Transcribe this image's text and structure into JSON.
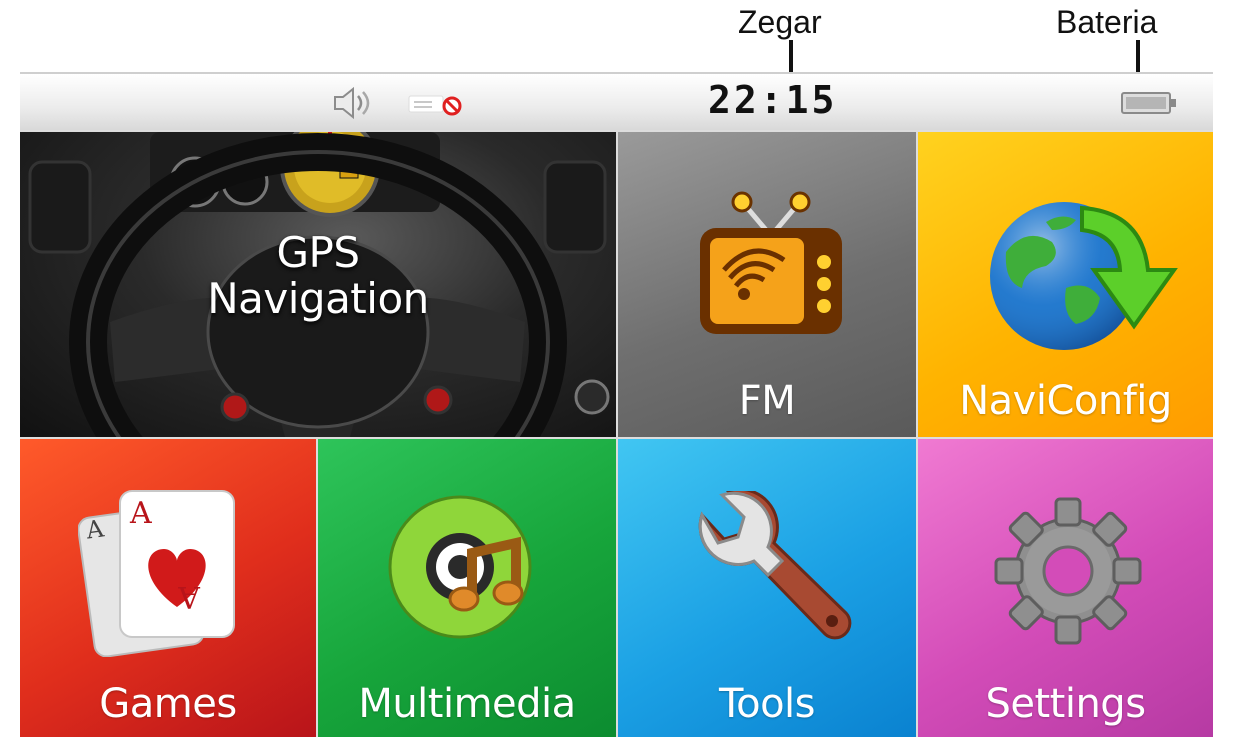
{
  "annotations": {
    "clock_label": "Zegar",
    "battery_label": "Bateria"
  },
  "status_bar": {
    "time": "22:15",
    "volume_icon": "speaker-icon",
    "notice_icon": "no-signal-icon",
    "battery_icon": "battery-icon"
  },
  "tiles": {
    "gps": {
      "line1": "GPS",
      "line2": "Navigation",
      "icon": "steering-wheel-image"
    },
    "fm": {
      "label": "FM",
      "icon": "tv-radio-icon",
      "color": "#7a7a7a"
    },
    "naviconfig": {
      "label": "NaviConfig",
      "icon": "globe-arrow-icon",
      "color": "#ffb300"
    },
    "games": {
      "label": "Games",
      "icon": "playing-cards-icon",
      "color": "#e02e1c"
    },
    "multimedia": {
      "label": "Multimedia",
      "icon": "music-disc-icon",
      "color": "#17a53b"
    },
    "tools": {
      "label": "Tools",
      "icon": "wrench-icon",
      "color": "#1ba0e4"
    },
    "settings": {
      "label": "Settings",
      "icon": "gear-icon",
      "color": "#d34cb8"
    }
  }
}
